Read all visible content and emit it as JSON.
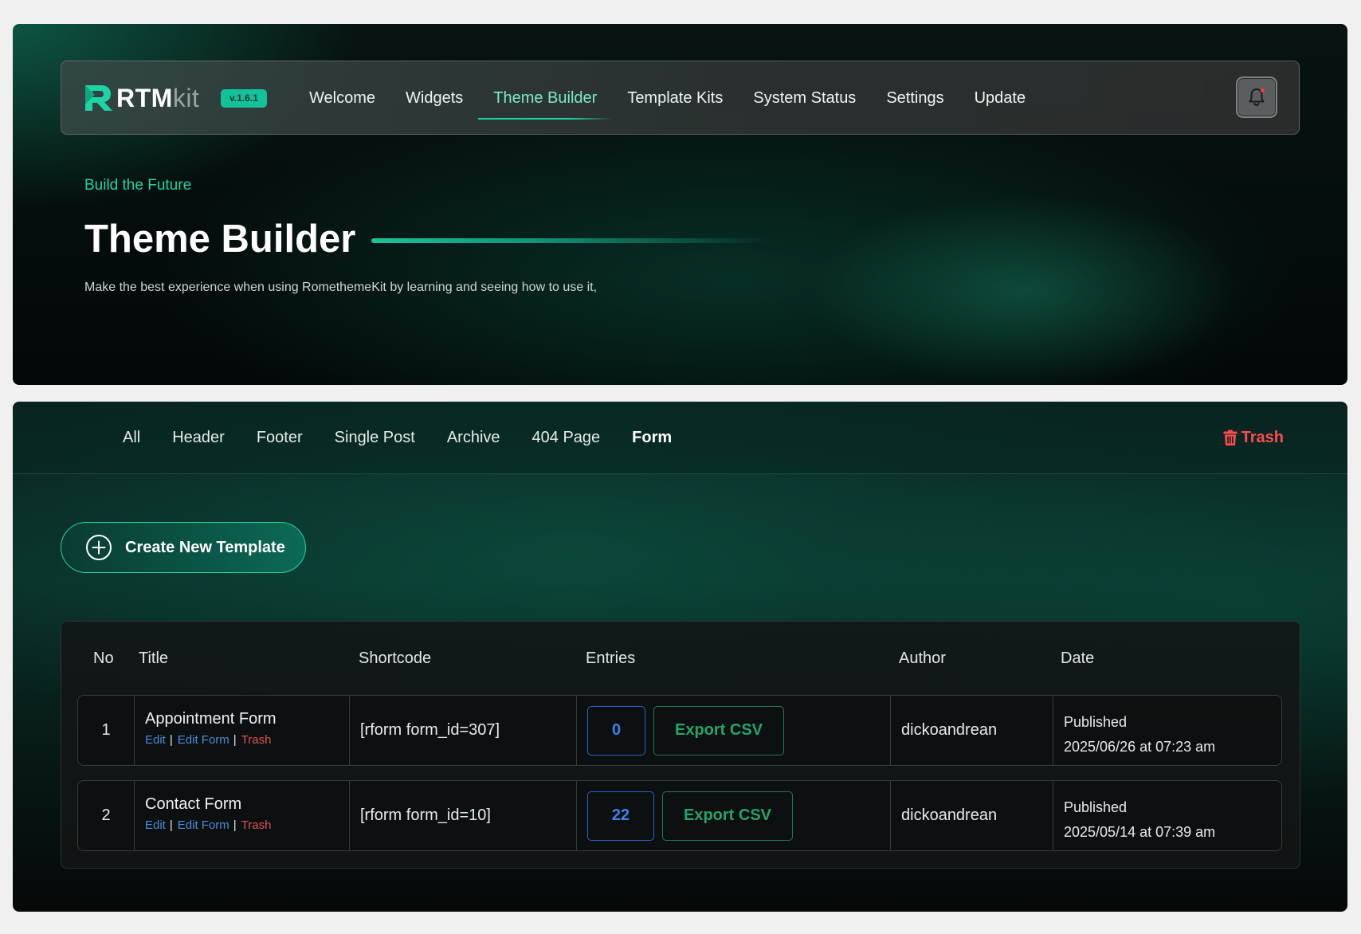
{
  "brand": {
    "name_bold": "RTM",
    "name_light": "kit",
    "version": "v.1.6.1",
    "accent": "#1fd4a4"
  },
  "nav": {
    "items": [
      {
        "label": "Welcome",
        "active": false
      },
      {
        "label": "Widgets",
        "active": false
      },
      {
        "label": "Theme Builder",
        "active": true
      },
      {
        "label": "Template Kits",
        "active": false
      },
      {
        "label": "System Status",
        "active": false
      },
      {
        "label": "Settings",
        "active": false
      },
      {
        "label": "Update",
        "active": false
      }
    ],
    "notification_icon": "bell-icon"
  },
  "hero": {
    "eyebrow": "Build the Future",
    "title": "Theme Builder",
    "description": "Make the best experience when using RomethemeKit by learning and seeing how to use it,"
  },
  "tabs": {
    "items": [
      {
        "label": "All",
        "active": false
      },
      {
        "label": "Header",
        "active": false
      },
      {
        "label": "Footer",
        "active": false
      },
      {
        "label": "Single Post",
        "active": false
      },
      {
        "label": "Archive",
        "active": false
      },
      {
        "label": "404 Page",
        "active": false
      },
      {
        "label": "Form",
        "active": true
      }
    ],
    "trash_label": "Trash",
    "trash_color": "#ff4d4d"
  },
  "create_button": {
    "label": "Create New Template",
    "icon": "plus-circle-icon"
  },
  "table": {
    "columns": [
      "No",
      "Title",
      "Shortcode",
      "Entries",
      "Author",
      "Date"
    ],
    "rows": [
      {
        "no": "1",
        "title": "Appointment Form",
        "actions": {
          "edit": "Edit",
          "edit_form": "Edit Form",
          "trash": "Trash"
        },
        "shortcode": "[rform form_id=307]",
        "entries": "0",
        "export_label": "Export CSV",
        "author": "dickoandrean",
        "status": "Published",
        "date": "2025/06/26 at 07:23 am"
      },
      {
        "no": "2",
        "title": "Contact Form",
        "actions": {
          "edit": "Edit",
          "edit_form": "Edit Form",
          "trash": "Trash"
        },
        "shortcode": "[rform form_id=10]",
        "entries": "22",
        "export_label": "Export CSV",
        "author": "dickoandrean",
        "status": "Published",
        "date": "2025/05/14 at 07:39 am"
      }
    ]
  }
}
